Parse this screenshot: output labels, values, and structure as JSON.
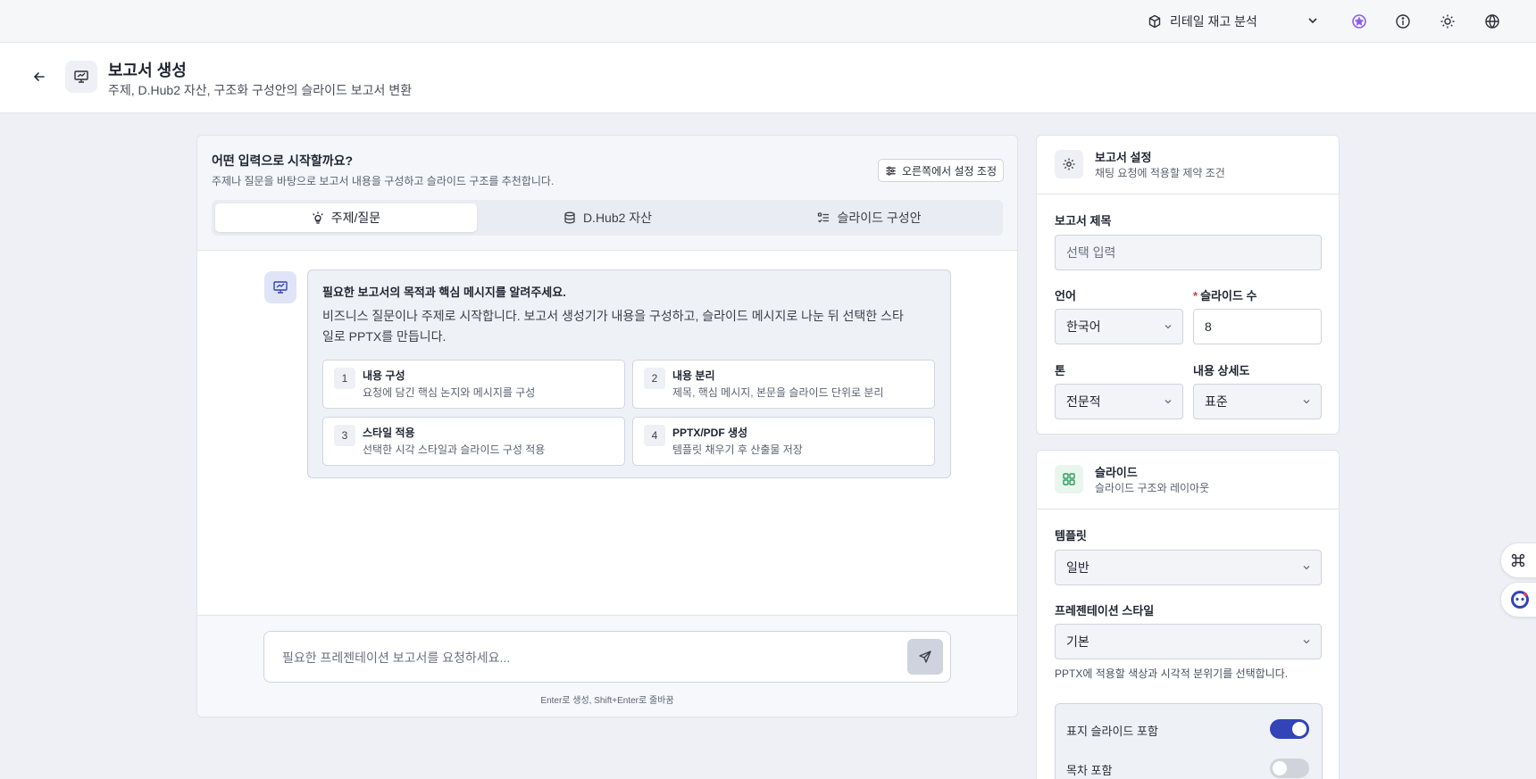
{
  "topbar": {
    "project_name": "리테일 재고 분석",
    "icons": [
      "box-icon",
      "chevron-down-icon",
      "ai-icon",
      "info-icon",
      "sun-icon",
      "globe-icon"
    ]
  },
  "header": {
    "title": "보고서 생성",
    "subtitle": "주제, D.Hub2 자산, 구조화 구성안의 슬라이드 보고서 변환"
  },
  "main": {
    "question_title": "어떤 입력으로 시작할까요?",
    "question_sub": "주제나 질문을 바탕으로 보고서 내용을 구성하고 슬라이드 구조를 추천합니다.",
    "adjust_label": "오른쪽에서 설정 조정",
    "tabs": [
      {
        "label": "주제/질문",
        "active": true
      },
      {
        "label": "D.Hub2 자산",
        "active": false
      },
      {
        "label": "슬라이드 구성안",
        "active": false
      }
    ],
    "bubble": {
      "title": "필요한 보고서의 목적과 핵심 메시지를 알려주세요.",
      "text": "비즈니스 질문이나 주제로 시작합니다. 보고서 생성기가 내용을 구성하고, 슬라이드 메시지로 나눈 뒤 선택한 스타일로 PPTX를 만듭니다.",
      "steps": [
        {
          "num": "1",
          "title": "내용 구성",
          "desc": "요청에 담긴 핵심 논지와 메시지를 구성"
        },
        {
          "num": "2",
          "title": "내용 분리",
          "desc": "제목, 핵심 메시지, 본문을 슬라이드 단위로 분리"
        },
        {
          "num": "3",
          "title": "스타일 적용",
          "desc": "선택한 시각 스타일과 슬라이드 구성 적용"
        },
        {
          "num": "4",
          "title": "PPTX/PDF 생성",
          "desc": "템플릿 채우기 후 산출물 저장"
        }
      ]
    },
    "composer": {
      "placeholder": "필요한 프레젠테이션 보고서를 요청하세요...",
      "value": "",
      "hint": "Enter로 생성, Shift+Enter로 줄바꿈"
    }
  },
  "report_settings": {
    "title": "보고서 설정",
    "subtitle": "채팅 요청에 적용할 제약 조건",
    "report_title_label": "보고서 제목",
    "report_title_placeholder": "선택 입력",
    "language_label": "언어",
    "language_value": "한국어",
    "slide_count_label": "슬라이드 수",
    "slide_count_value": "8",
    "tone_label": "톤",
    "tone_value": "전문적",
    "detail_label": "내용 상세도",
    "detail_value": "표준"
  },
  "slides": {
    "title": "슬라이드",
    "subtitle": "슬라이드 구조와 레이아웃",
    "template_label": "템플릿",
    "template_value": "일반",
    "style_label": "프레젠테이션 스타일",
    "style_value": "기본",
    "style_help": "PPTX에 적용할 색상과 시각적 분위기를 선택합니다.",
    "toggles": [
      {
        "label": "표지 슬라이드 포함",
        "on": true
      },
      {
        "label": "목차 포함",
        "on": false
      }
    ]
  },
  "colors": {
    "accent": "#3343b8",
    "ai_purple": "#8b5cf6",
    "slides_green": "#2f9e5b"
  }
}
